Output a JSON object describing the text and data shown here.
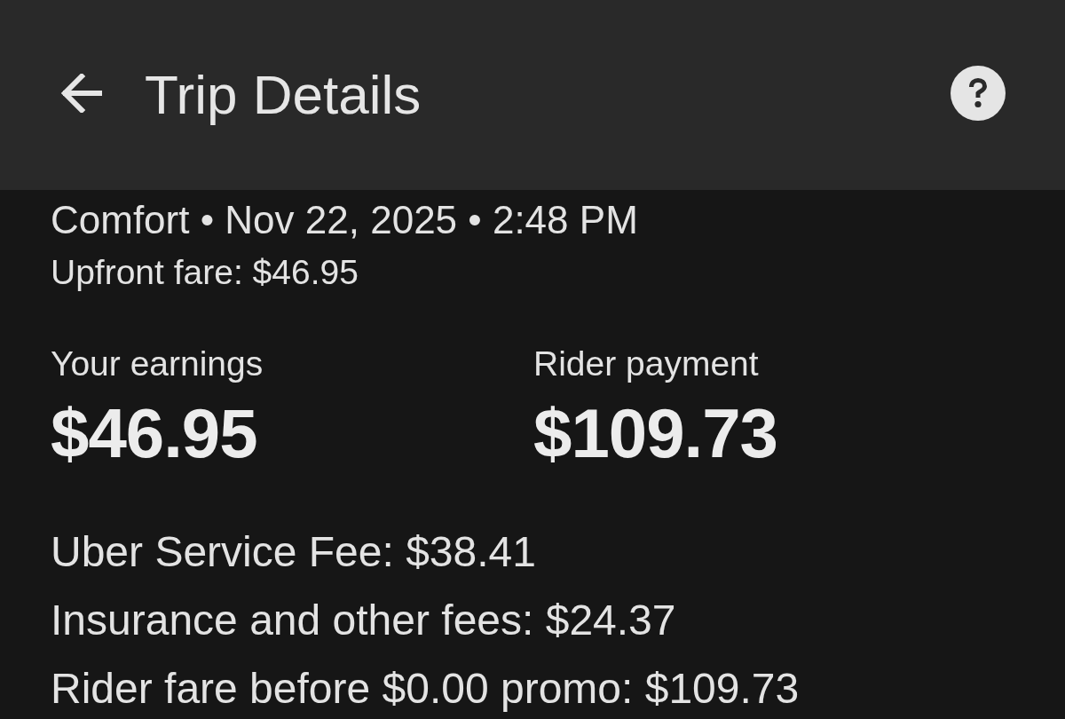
{
  "header": {
    "title": "Trip Details"
  },
  "trip": {
    "summary": "Comfort • Nov 22, 2025 • 2:48 PM",
    "upfront_fare": "Upfront fare: $46.95"
  },
  "totals": [
    {
      "label": "Your earnings",
      "amount": "$46.95"
    },
    {
      "label": "Rider payment",
      "amount": "$109.73"
    }
  ],
  "fees": [
    "Uber Service Fee: $38.41",
    "Insurance and other fees: $24.37",
    "Rider fare before $0.00 promo: $109.73"
  ]
}
